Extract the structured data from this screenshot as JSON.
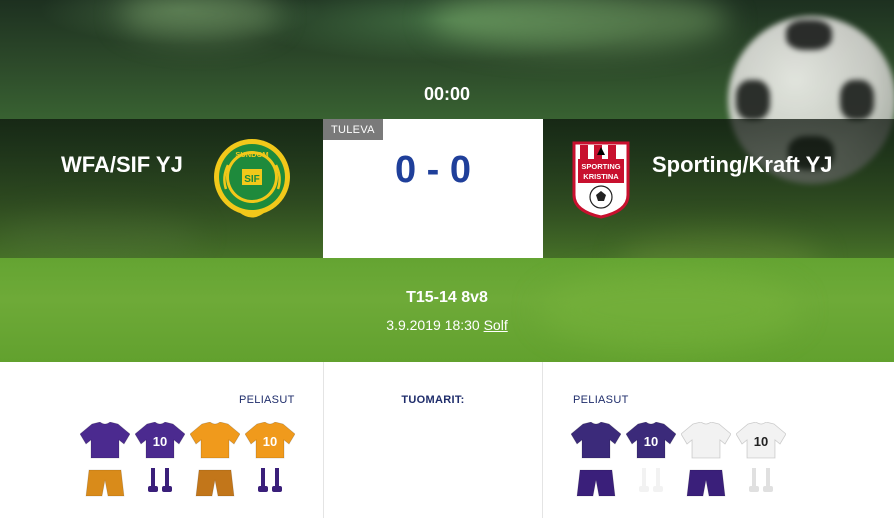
{
  "match": {
    "time": "00:00",
    "status": "TULEVA",
    "score": "0 - 0",
    "series": "T15-14 8v8",
    "date_time": "3.9.2019 18:30",
    "venue": "Solf"
  },
  "home_team": {
    "name": "WFA/SIF YJ",
    "logo_text": "SUNDOM",
    "logo_icon": "sundom-club-crest",
    "kit_label": "PELIASUT",
    "kits": [
      {
        "type": "shirt-shorts-socks",
        "shirt": "#4b2a8f",
        "shorts": "#d98b1a",
        "number": ""
      },
      {
        "type": "shirt-shorts-socks",
        "shirt": "#4b2a8f",
        "shorts": "#3a1f7a",
        "number": "10"
      },
      {
        "type": "shirt-shorts-socks",
        "shirt": "#f09a1c",
        "shorts": "#c2761a",
        "number": ""
      },
      {
        "type": "shirt-shorts-socks",
        "shirt": "#f09a1c",
        "shorts": "#3a1f7a",
        "number": "10"
      }
    ]
  },
  "away_team": {
    "name": "Sporting/Kraft YJ",
    "logo_text": "SPORTING KRISTINA",
    "logo_icon": "sporting-kristina-crest",
    "kit_label": "PELIASUT",
    "kits": [
      {
        "type": "shirt-shorts-socks",
        "shirt": "#3b2a7a",
        "shorts": "#3a1f7a",
        "number": ""
      },
      {
        "type": "shirt-shorts-socks",
        "shirt": "#3b2a7a",
        "shorts": "#f2f2f2",
        "number": "10"
      },
      {
        "type": "shirt-shorts-socks",
        "shirt": "#f2f2f2",
        "shorts": "#3a1f7a",
        "number": ""
      },
      {
        "type": "shirt-shorts-socks",
        "shirt": "#f2f2f2",
        "shorts": "#e0e0e0",
        "number": "10"
      }
    ]
  },
  "referees": {
    "label": "TUOMARIT:"
  },
  "colors": {
    "score": "#1f3f9a",
    "labels": "#1f2d6b",
    "status_tag": "#7a7a7a"
  }
}
